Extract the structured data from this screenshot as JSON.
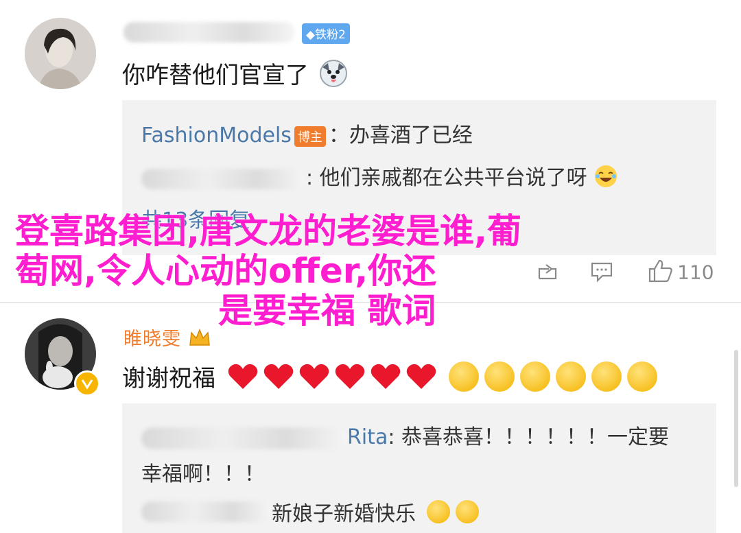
{
  "comment1": {
    "badge": "◆铁粉2",
    "text": "你咋替他们官宣了"
  },
  "reply_box1": {
    "line1_user": "FashionModels",
    "line1_badge": "博主",
    "line1_text": "：办喜酒了已经",
    "line2_text": ": 他们亲戚都在公共平台说了呀",
    "more": "共13条回复"
  },
  "actions1": {
    "like_count": "110"
  },
  "comment2": {
    "username": "睢晓雯",
    "text": "谢谢祝福"
  },
  "reply_box2": {
    "line1_user_tail": "Rita",
    "line1_text": ": 恭喜恭喜！！！！！！一定要",
    "line1_cont": "幸福啊！！！",
    "line2_text": "新娘子新婚快乐"
  },
  "overlay": {
    "line1": "登喜路集团,唐文龙的老婆是谁,葡",
    "line2": "萄网,令人心动的offer,你还",
    "line3": "是要幸福 歌词"
  },
  "colors": {
    "overlay": "#ff1ecf",
    "reply_user": "#4a79a9",
    "author_badge": "#f07d2e",
    "fan_badge": "#5fa8f0"
  }
}
